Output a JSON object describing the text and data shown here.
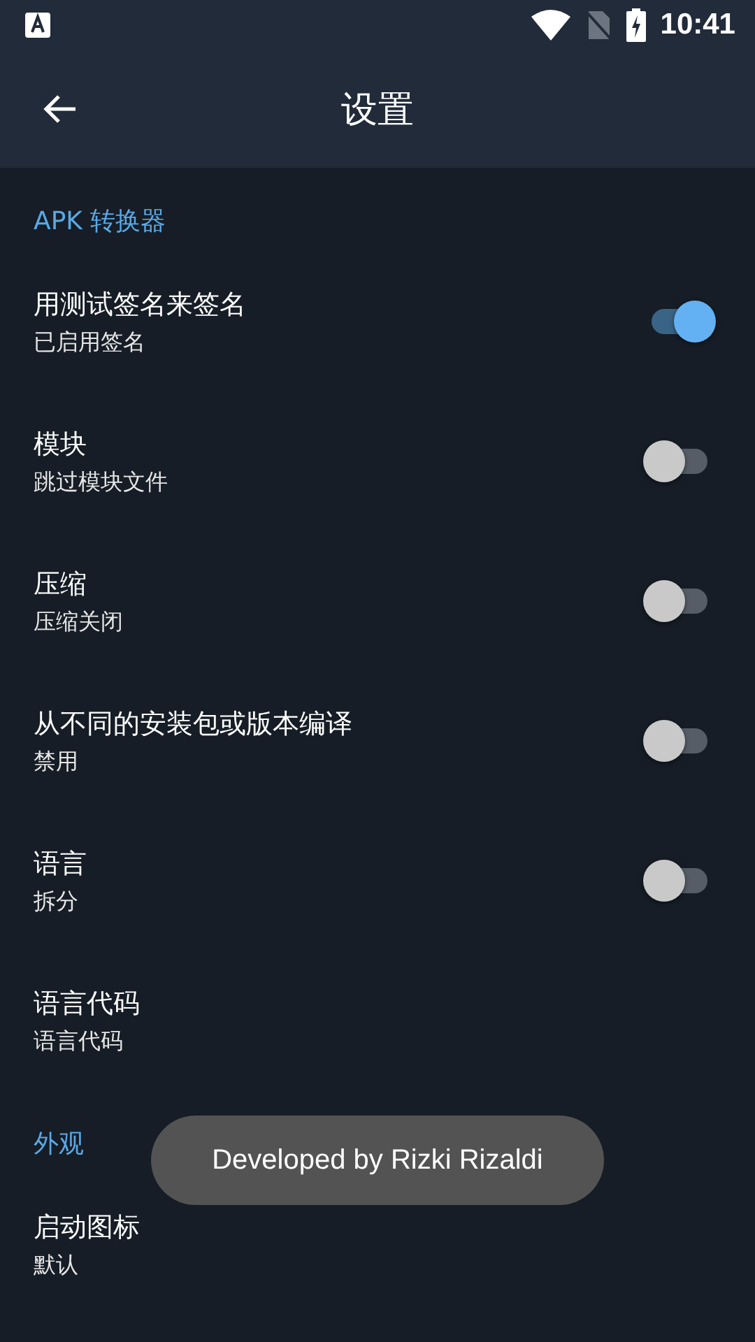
{
  "status_bar": {
    "time": "10:41"
  },
  "app_bar": {
    "title": "设置"
  },
  "sections": [
    {
      "header": "APK 转换器",
      "items": [
        {
          "kind": "switch",
          "title": "用测试签名来签名",
          "subtitle": "已启用签名",
          "on": true
        },
        {
          "kind": "switch",
          "title": "模块",
          "subtitle": "跳过模块文件",
          "on": false
        },
        {
          "kind": "switch",
          "title": "压缩",
          "subtitle": "压缩关闭",
          "on": false
        },
        {
          "kind": "switch",
          "title": "从不同的安装包或版本编译",
          "subtitle": "禁用",
          "on": false
        },
        {
          "kind": "switch",
          "title": "语言",
          "subtitle": "拆分",
          "on": false
        },
        {
          "kind": "plain",
          "title": "语言代码",
          "subtitle": "语言代码"
        }
      ]
    },
    {
      "header": "外观",
      "items": [
        {
          "kind": "plain",
          "title": "启动图标",
          "subtitle": "默认"
        }
      ]
    }
  ],
  "toast": {
    "text": "Developed by Rizki Rizaldi"
  }
}
